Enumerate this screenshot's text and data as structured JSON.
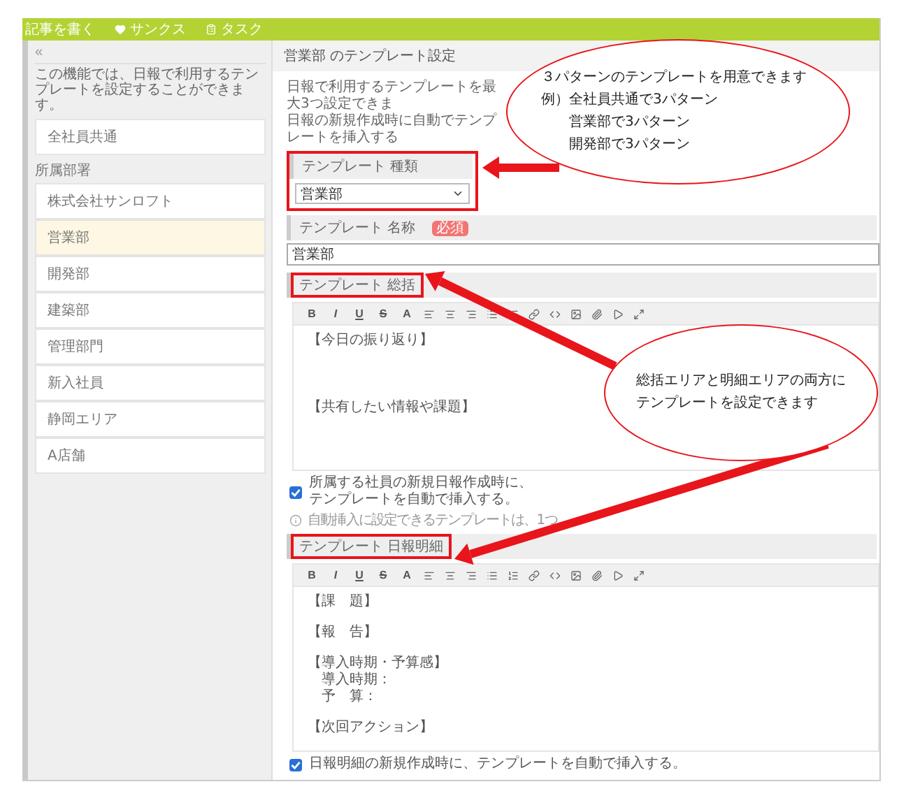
{
  "top_bar": {
    "items": [
      {
        "label": "記事を書く"
      },
      {
        "label": "サンクス"
      },
      {
        "label": "タスク"
      }
    ]
  },
  "sidebar": {
    "collapse": "«",
    "description": "この機能では、日報で利用するテンプレートを設定することができます。",
    "common_items": [
      {
        "label": "全社員共通",
        "selected": false
      }
    ],
    "group_label": "所属部署",
    "items": [
      {
        "label": "株式会社サンロフト",
        "selected": false
      },
      {
        "label": "営業部",
        "selected": true
      },
      {
        "label": "開発部",
        "selected": false
      },
      {
        "label": "建築部",
        "selected": false
      },
      {
        "label": "管理部門",
        "selected": false
      },
      {
        "label": "新入社員",
        "selected": false
      },
      {
        "label": "静岡エリア",
        "selected": false
      },
      {
        "label": "A店舗",
        "selected": false
      }
    ]
  },
  "main": {
    "title": "営業部 のテンプレート設定",
    "description": [
      "日報で利用するテンプレートを最大3つ設定できま",
      "日報の新規作成時に自動でテンプレートを挿入する"
    ],
    "template_type": {
      "label": "テンプレート 種類",
      "value": "営業部",
      "highlighted": true
    },
    "template_name": {
      "label": "テンプレート 名称",
      "badge": "必須",
      "value": "営業部"
    },
    "summary": {
      "label": "テンプレート 総括",
      "highlighted": true,
      "toolbar": [
        "B",
        "I",
        "U",
        "S",
        "A"
      ],
      "blocks": [
        [
          "【今日の振り返り】"
        ],
        [
          "【共有したい情報や課題】"
        ]
      ],
      "auto_insert": {
        "label": "所属する社員の新規日報作成時に、テンプレートを自動で挿入する。",
        "checked": true
      },
      "note": "自動挿入に設定できるテンプレートは、1つ"
    },
    "detail": {
      "label": "テンプレート 日報明細",
      "highlighted": true,
      "toolbar": [
        "B",
        "I",
        "U",
        "S",
        "A"
      ],
      "blocks": [
        [
          "【課　題】"
        ],
        [
          "【報　告】"
        ],
        [
          "【導入時期・予算感】",
          "　導入時期：",
          "　予　算："
        ],
        [
          "【次回アクション】"
        ]
      ],
      "auto_insert": {
        "label": "日報明細の新規作成時に、テンプレートを自動で挿入する。",
        "checked": true
      }
    }
  },
  "callouts": [
    {
      "lines": [
        "３パターンのテンプレートを用意できます",
        "例）全社員共通で3パターン",
        "　　営業部で3パターン",
        "　　開発部で3パターン"
      ]
    },
    {
      "lines": [
        "総括エリアと明細エリアの両方に",
        "テンプレートを設定できます"
      ]
    }
  ]
}
